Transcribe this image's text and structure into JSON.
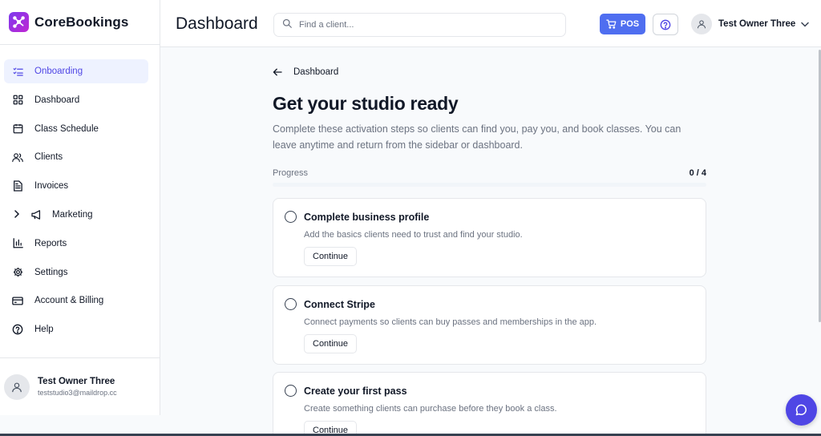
{
  "brand": {
    "name": "CoreBookings",
    "accent": "#4f6ef0"
  },
  "sidebar": {
    "items": [
      {
        "label": "Onboarding",
        "icon": "checklist-icon",
        "active": true
      },
      {
        "label": "Dashboard",
        "icon": "grid-icon"
      },
      {
        "label": "Class Schedule",
        "icon": "calendar-icon"
      },
      {
        "label": "Clients",
        "icon": "users-icon"
      },
      {
        "label": "Invoices",
        "icon": "document-icon"
      },
      {
        "label": "Marketing",
        "icon": "megaphone-icon",
        "expandable": true
      },
      {
        "label": "Reports",
        "icon": "bar-chart-icon"
      },
      {
        "label": "Settings",
        "icon": "gear-icon"
      },
      {
        "label": "Account & Billing",
        "icon": "credit-card-icon"
      },
      {
        "label": "Help",
        "icon": "help-circle-icon"
      }
    ],
    "user": {
      "name": "Test Owner Three",
      "email": "teststudio3@maildrop.cc"
    }
  },
  "header": {
    "title": "Dashboard",
    "search_placeholder": "Find a client...",
    "pos_label": "POS",
    "account_name": "Test Owner Three"
  },
  "main": {
    "back_label": "Dashboard",
    "title": "Get your studio ready",
    "description": "Complete these activation steps so clients can find you, pay you, and book classes. You can leave anytime and return from the sidebar or dashboard.",
    "progress": {
      "label": "Progress",
      "count": "0 / 4",
      "fraction": 0
    },
    "steps": [
      {
        "title": "Complete business profile",
        "description": "Add the basics clients need to trust and find your studio.",
        "button": "Continue"
      },
      {
        "title": "Connect Stripe",
        "description": "Connect payments so clients can buy passes and memberships in the app.",
        "button": "Continue"
      },
      {
        "title": "Create your first pass",
        "description": "Create something clients can purchase before they book a class.",
        "button": "Continue"
      }
    ]
  }
}
